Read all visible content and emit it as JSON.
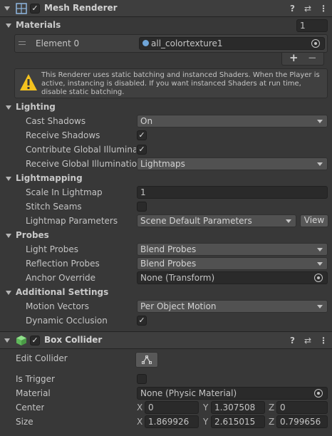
{
  "mesh_renderer": {
    "title": "Mesh Renderer",
    "materials": {
      "label": "Materials",
      "count": "1",
      "element_label": "Element 0",
      "element_value": "all_colortexture1",
      "add": "+",
      "remove": "−"
    },
    "warning": "This Renderer uses static batching and instanced Shaders. When the Player is active, instancing is disabled. If you want instanced Shaders at run time, disable static batching.",
    "lighting": {
      "label": "Lighting",
      "cast_shadows_label": "Cast Shadows",
      "cast_shadows_value": "On",
      "receive_shadows_label": "Receive Shadows",
      "contribute_gi_label": "Contribute Global Illuminatio",
      "receive_gi_label": "Receive Global Illumination",
      "receive_gi_value": "Lightmaps"
    },
    "lightmapping": {
      "label": "Lightmapping",
      "scale_label": "Scale In Lightmap",
      "scale_value": "1",
      "stitch_label": "Stitch Seams",
      "params_label": "Lightmap Parameters",
      "params_value": "Scene Default Parameters",
      "view_button": "View"
    },
    "probes": {
      "label": "Probes",
      "light_label": "Light Probes",
      "light_value": "Blend Probes",
      "reflection_label": "Reflection Probes",
      "reflection_value": "Blend Probes",
      "anchor_label": "Anchor Override",
      "anchor_value": "None (Transform)"
    },
    "additional": {
      "label": "Additional Settings",
      "motion_label": "Motion Vectors",
      "motion_value": "Per Object Motion",
      "dynamic_label": "Dynamic Occlusion"
    }
  },
  "box_collider": {
    "title": "Box Collider",
    "edit_label": "Edit Collider",
    "trigger_label": "Is Trigger",
    "material_label": "Material",
    "material_value": "None (Physic Material)",
    "center_label": "Center",
    "center": {
      "x": "0",
      "y": "1.307508",
      "z": "0"
    },
    "size_label": "Size",
    "size": {
      "x": "1.869926",
      "y": "2.615015",
      "z": "0.799656"
    },
    "axis_x": "X",
    "axis_y": "Y",
    "axis_z": "Z"
  },
  "icons": {
    "help": "?",
    "presets": "⇄",
    "menu": "⋮",
    "check": "✓"
  }
}
